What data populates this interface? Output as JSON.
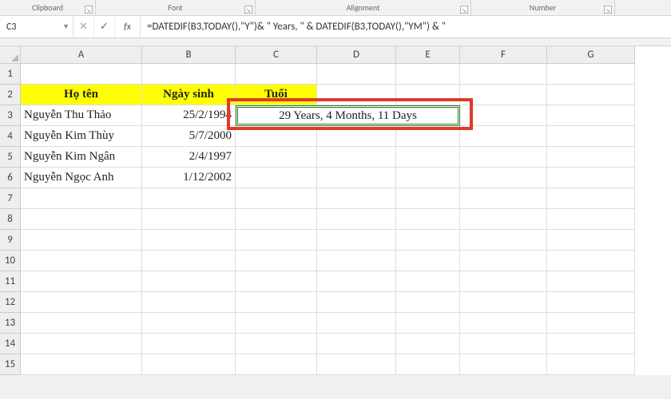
{
  "ribbon": {
    "groups": [
      "Clipboard",
      "Font",
      "Alignment",
      "Number"
    ]
  },
  "nameBox": "C3",
  "fx": "fx",
  "formula": "=DATEDIF(B3,TODAY(),\"Y\")& \" Years, \" & DATEDIF(B3,TODAY(),\"YM\") & \"",
  "columns": [
    "A",
    "B",
    "C",
    "D",
    "E",
    "F",
    "G"
  ],
  "rows": [
    "1",
    "2",
    "3",
    "4",
    "5",
    "6",
    "7",
    "8",
    "9",
    "10",
    "11",
    "12",
    "13",
    "14",
    "15"
  ],
  "headers": {
    "name": "Họ tên",
    "dob": "Ngày sinh",
    "age": "Tuổi"
  },
  "data": [
    {
      "name": "Nguyễn Thu Thảo",
      "dob": "25/2/1994",
      "age": "29 Years, 4 Months, 11 Days"
    },
    {
      "name": "Nguyễn Kim Thùy",
      "dob": "5/7/2000",
      "age": ""
    },
    {
      "name": "Nguyễn Kim Ngân",
      "dob": "2/4/1997",
      "age": ""
    },
    {
      "name": "Nguyễn Ngọc Anh",
      "dob": "1/12/2002",
      "age": ""
    }
  ]
}
